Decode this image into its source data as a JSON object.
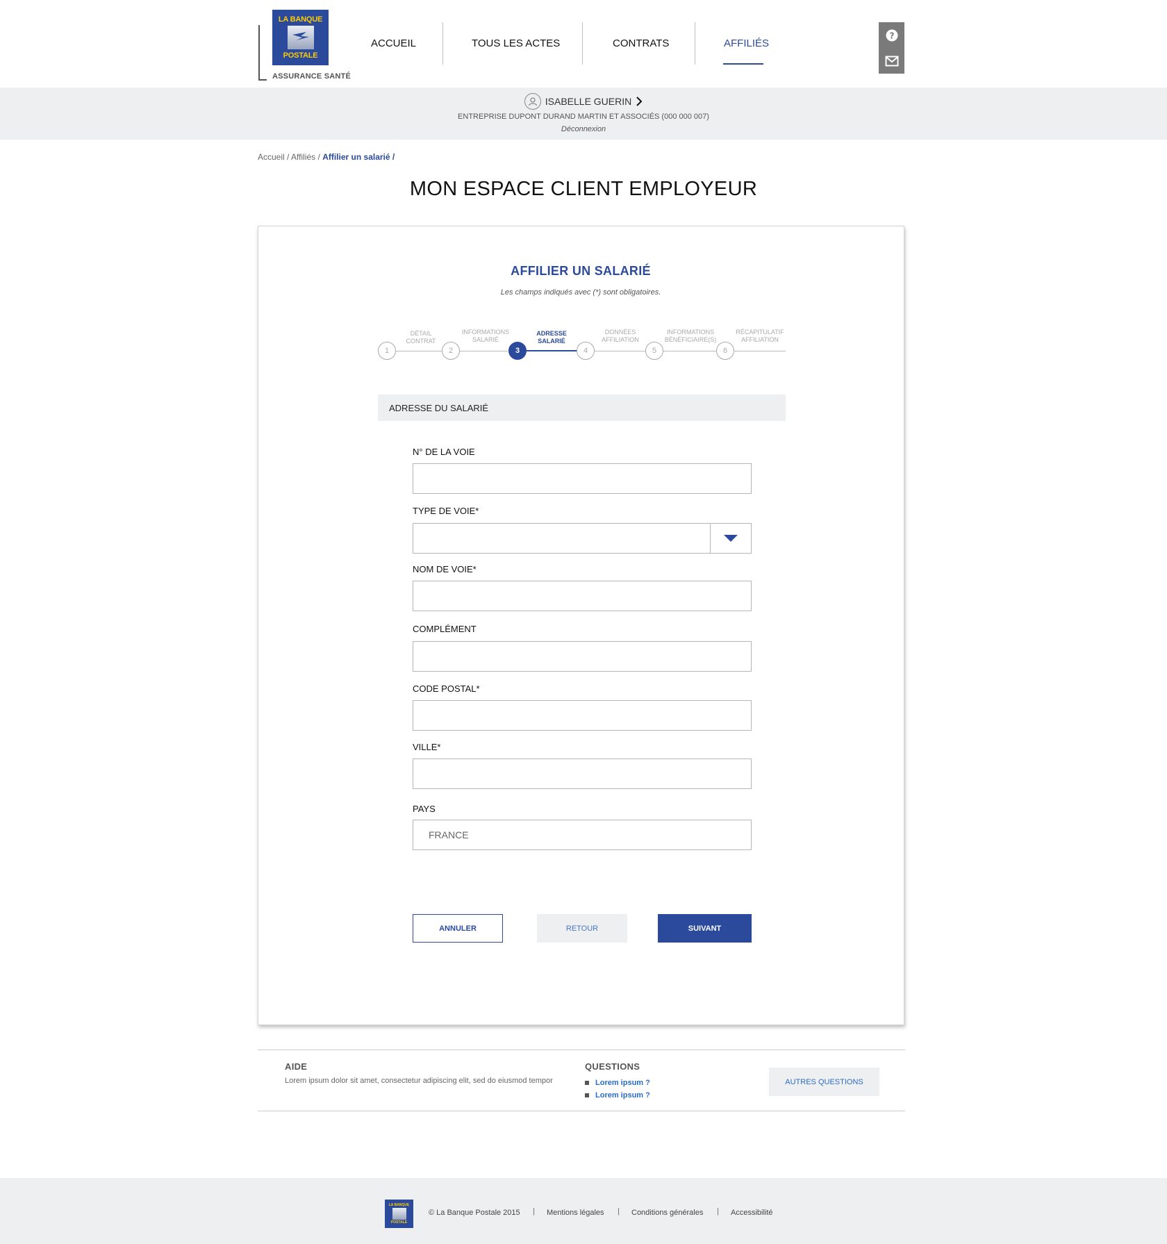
{
  "header": {
    "logo_line1": "LA BANQUE",
    "logo_line2": "POSTALE",
    "logo_sub": "ASSURANCE SANTÉ",
    "nav": [
      {
        "label": "ACCUEIL"
      },
      {
        "label": "TOUS LES ACTES"
      },
      {
        "label": "CONTRATS"
      },
      {
        "label": "AFFILIÉS",
        "active": true
      }
    ],
    "help_icon": "question-icon",
    "mail_icon": "mail-icon"
  },
  "user": {
    "name": "ISABELLE GUERIN",
    "company": "ENTREPRISE DUPONT DURAND MARTIN ET ASSOCIÉS (000 000 007)",
    "logout": "Déconnexion"
  },
  "breadcrumb": {
    "home": "Accueil",
    "sep": " / ",
    "affilies": "Affiliés",
    "current": "Affilier un salarié /"
  },
  "page": {
    "title": "MON ESPACE CLIENT EMPLOYEUR"
  },
  "form": {
    "title": "AFFILIER UN SALARIÉ",
    "note": "Les champs indiqués avec (*) sont obligatoires.",
    "steps": [
      {
        "num": "1",
        "l1": "DÉTAIL",
        "l2": "CONTRAT"
      },
      {
        "num": "2",
        "l1": "INFORMATIONS",
        "l2": "SALARIÉ"
      },
      {
        "num": "3",
        "l1": "ADRESSE",
        "l2": "SALARIÉ",
        "active": true
      },
      {
        "num": "4",
        "l1": "DONNÉES",
        "l2": "AFFILIATION"
      },
      {
        "num": "5",
        "l1": "INFORMATIONS",
        "l2": "BÉNÉFICIAIRE(S)"
      },
      {
        "num": "6",
        "l1": "RÉCAPITULATIF",
        "l2": "AFFILIATION"
      }
    ],
    "section": "ADRESSE DU SALARIÉ",
    "fields": {
      "numero_label": "N° DE LA VOIE",
      "numero_value": "",
      "type_label": "TYPE DE VOIE*",
      "type_value": "",
      "nom_label": "NOM DE VOIE*",
      "nom_value": "",
      "complement_label": "COMPLÉMENT",
      "complement_value": "",
      "cp_label": "CODE POSTAL*",
      "cp_value": "",
      "ville_label": "VILLE*",
      "ville_value": "",
      "pays_label": "PAYS",
      "pays_value": "FRANCE"
    },
    "buttons": {
      "cancel": "ANNULER",
      "back": "RETOUR",
      "next": "SUIVANT"
    }
  },
  "help": {
    "aide_title": "AIDE",
    "aide_text": "Lorem ipsum dolor sit amet, consectetur adipiscing elit, sed do eiusmod tempor",
    "questions_title": "QUESTIONS",
    "questions": [
      "Lorem ipsum ?",
      "Lorem ipsum ?"
    ],
    "more": "AUTRES QUESTIONS"
  },
  "footer": {
    "logo_line1": "LA BANQUE",
    "logo_line2": "POSTALE",
    "copyright": "© La Banque Postale 2015",
    "mentions": "Mentions légales",
    "conditions": "Conditions générales",
    "accessibilite": "Accessibilité",
    "sep": "|"
  },
  "colors": {
    "brand_blue": "#2b4a9b",
    "brand_yellow": "#ffcc00",
    "link_blue": "#2b6cc4",
    "band_grey": "#eeeff0"
  }
}
